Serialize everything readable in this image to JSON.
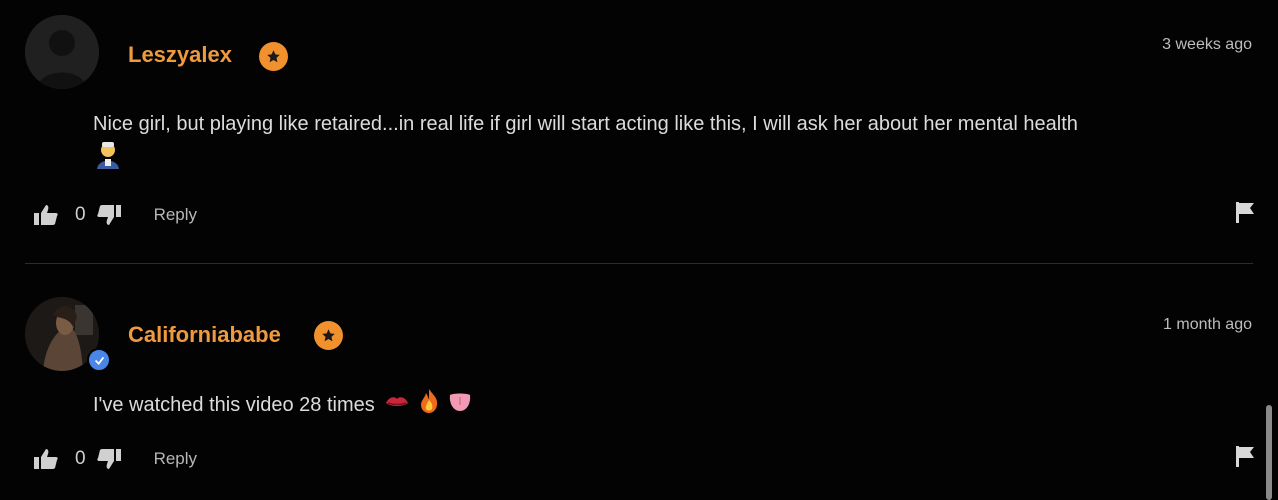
{
  "comments": [
    {
      "username": "Leszyalex",
      "time": "3 weeks ago",
      "text_line1": "Nice girl, but playing like retaired...in real life if girl will start acting like this, I will ask her about her mental health",
      "emoji_names": [
        "health-worker-emoji"
      ],
      "likes": "0",
      "reply_label": "Reply",
      "verified": false
    },
    {
      "username": "Californiababe",
      "time": "1 month ago",
      "text_line1": "I've watched this video 28 times",
      "emoji_names": [
        "kiss-mark-emoji",
        "fire-emoji",
        "tongue-emoji"
      ],
      "likes": "0",
      "reply_label": "Reply",
      "verified": true
    }
  ],
  "colors": {
    "background": "#030303",
    "username": "#ef9a3f",
    "badge": "#f0912e",
    "verified": "#4a86e8"
  },
  "icons": [
    "star-badge-icon",
    "thumbs-up-icon",
    "thumbs-down-icon",
    "flag-icon",
    "verified-check-icon"
  ]
}
